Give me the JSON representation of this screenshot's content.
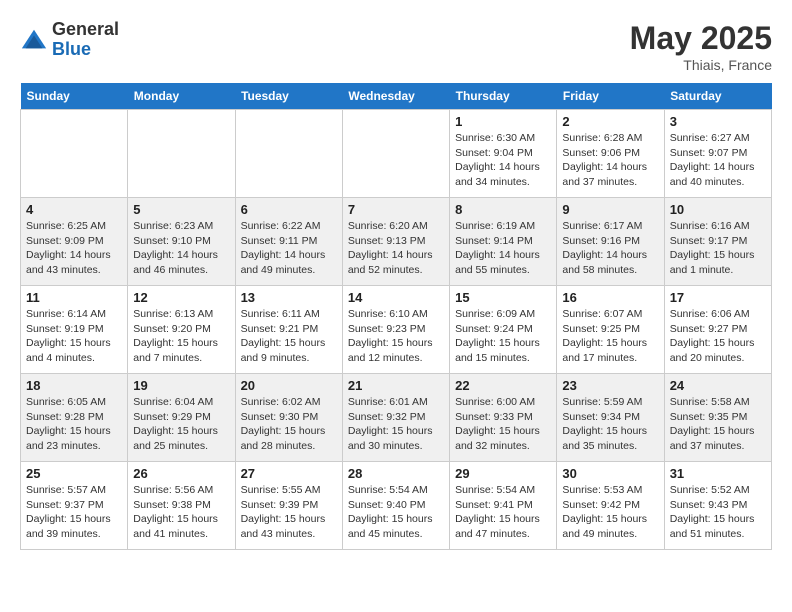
{
  "header": {
    "logo_line1": "General",
    "logo_line2": "Blue",
    "month_year": "May 2025",
    "location": "Thiais, France"
  },
  "days_of_week": [
    "Sunday",
    "Monday",
    "Tuesday",
    "Wednesday",
    "Thursday",
    "Friday",
    "Saturday"
  ],
  "weeks": [
    [
      {
        "day": "",
        "info": ""
      },
      {
        "day": "",
        "info": ""
      },
      {
        "day": "",
        "info": ""
      },
      {
        "day": "",
        "info": ""
      },
      {
        "day": "1",
        "info": "Sunrise: 6:30 AM\nSunset: 9:04 PM\nDaylight: 14 hours\nand 34 minutes."
      },
      {
        "day": "2",
        "info": "Sunrise: 6:28 AM\nSunset: 9:06 PM\nDaylight: 14 hours\nand 37 minutes."
      },
      {
        "day": "3",
        "info": "Sunrise: 6:27 AM\nSunset: 9:07 PM\nDaylight: 14 hours\nand 40 minutes."
      }
    ],
    [
      {
        "day": "4",
        "info": "Sunrise: 6:25 AM\nSunset: 9:09 PM\nDaylight: 14 hours\nand 43 minutes."
      },
      {
        "day": "5",
        "info": "Sunrise: 6:23 AM\nSunset: 9:10 PM\nDaylight: 14 hours\nand 46 minutes."
      },
      {
        "day": "6",
        "info": "Sunrise: 6:22 AM\nSunset: 9:11 PM\nDaylight: 14 hours\nand 49 minutes."
      },
      {
        "day": "7",
        "info": "Sunrise: 6:20 AM\nSunset: 9:13 PM\nDaylight: 14 hours\nand 52 minutes."
      },
      {
        "day": "8",
        "info": "Sunrise: 6:19 AM\nSunset: 9:14 PM\nDaylight: 14 hours\nand 55 minutes."
      },
      {
        "day": "9",
        "info": "Sunrise: 6:17 AM\nSunset: 9:16 PM\nDaylight: 14 hours\nand 58 minutes."
      },
      {
        "day": "10",
        "info": "Sunrise: 6:16 AM\nSunset: 9:17 PM\nDaylight: 15 hours\nand 1 minute."
      }
    ],
    [
      {
        "day": "11",
        "info": "Sunrise: 6:14 AM\nSunset: 9:19 PM\nDaylight: 15 hours\nand 4 minutes."
      },
      {
        "day": "12",
        "info": "Sunrise: 6:13 AM\nSunset: 9:20 PM\nDaylight: 15 hours\nand 7 minutes."
      },
      {
        "day": "13",
        "info": "Sunrise: 6:11 AM\nSunset: 9:21 PM\nDaylight: 15 hours\nand 9 minutes."
      },
      {
        "day": "14",
        "info": "Sunrise: 6:10 AM\nSunset: 9:23 PM\nDaylight: 15 hours\nand 12 minutes."
      },
      {
        "day": "15",
        "info": "Sunrise: 6:09 AM\nSunset: 9:24 PM\nDaylight: 15 hours\nand 15 minutes."
      },
      {
        "day": "16",
        "info": "Sunrise: 6:07 AM\nSunset: 9:25 PM\nDaylight: 15 hours\nand 17 minutes."
      },
      {
        "day": "17",
        "info": "Sunrise: 6:06 AM\nSunset: 9:27 PM\nDaylight: 15 hours\nand 20 minutes."
      }
    ],
    [
      {
        "day": "18",
        "info": "Sunrise: 6:05 AM\nSunset: 9:28 PM\nDaylight: 15 hours\nand 23 minutes."
      },
      {
        "day": "19",
        "info": "Sunrise: 6:04 AM\nSunset: 9:29 PM\nDaylight: 15 hours\nand 25 minutes."
      },
      {
        "day": "20",
        "info": "Sunrise: 6:02 AM\nSunset: 9:30 PM\nDaylight: 15 hours\nand 28 minutes."
      },
      {
        "day": "21",
        "info": "Sunrise: 6:01 AM\nSunset: 9:32 PM\nDaylight: 15 hours\nand 30 minutes."
      },
      {
        "day": "22",
        "info": "Sunrise: 6:00 AM\nSunset: 9:33 PM\nDaylight: 15 hours\nand 32 minutes."
      },
      {
        "day": "23",
        "info": "Sunrise: 5:59 AM\nSunset: 9:34 PM\nDaylight: 15 hours\nand 35 minutes."
      },
      {
        "day": "24",
        "info": "Sunrise: 5:58 AM\nSunset: 9:35 PM\nDaylight: 15 hours\nand 37 minutes."
      }
    ],
    [
      {
        "day": "25",
        "info": "Sunrise: 5:57 AM\nSunset: 9:37 PM\nDaylight: 15 hours\nand 39 minutes."
      },
      {
        "day": "26",
        "info": "Sunrise: 5:56 AM\nSunset: 9:38 PM\nDaylight: 15 hours\nand 41 minutes."
      },
      {
        "day": "27",
        "info": "Sunrise: 5:55 AM\nSunset: 9:39 PM\nDaylight: 15 hours\nand 43 minutes."
      },
      {
        "day": "28",
        "info": "Sunrise: 5:54 AM\nSunset: 9:40 PM\nDaylight: 15 hours\nand 45 minutes."
      },
      {
        "day": "29",
        "info": "Sunrise: 5:54 AM\nSunset: 9:41 PM\nDaylight: 15 hours\nand 47 minutes."
      },
      {
        "day": "30",
        "info": "Sunrise: 5:53 AM\nSunset: 9:42 PM\nDaylight: 15 hours\nand 49 minutes."
      },
      {
        "day": "31",
        "info": "Sunrise: 5:52 AM\nSunset: 9:43 PM\nDaylight: 15 hours\nand 51 minutes."
      }
    ]
  ]
}
